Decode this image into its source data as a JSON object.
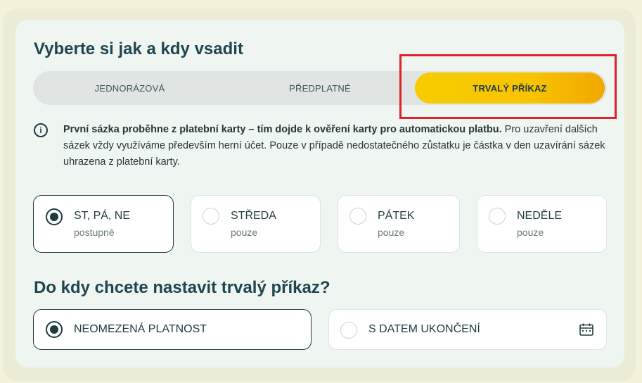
{
  "heading": "Vyberte si jak a kdy vsadit",
  "tabs": [
    {
      "label": "JEDNORÁZOVÁ"
    },
    {
      "label": "PŘEDPLATNÉ"
    },
    {
      "label": "TRVALÝ PŘÍKAZ"
    }
  ],
  "info": {
    "bold": "První sázka proběhne z platební karty – tím dojde k ověření karty pro automatickou platbu.",
    "rest": " Pro uzavření dalších sázek vždy využíváme především herní účet. Pouze v případě nedostatečného zůstatku je částka v den uzavírání sázek uhrazena z platební karty."
  },
  "days": [
    {
      "title": "ST, PÁ, NE",
      "sub": "postupně"
    },
    {
      "title": "STŘEDA",
      "sub": "pouze"
    },
    {
      "title": "PÁTEK",
      "sub": "pouze"
    },
    {
      "title": "NEDĚLE",
      "sub": "pouze"
    }
  ],
  "heading2": "Do kdy chcete nastavit trvalý příkaz?",
  "validity": [
    {
      "title": "NEOMEZENÁ PLATNOST"
    },
    {
      "title": "S DATEM UKONČENÍ"
    }
  ],
  "colors": {
    "accent": "#f6cc00",
    "dark": "#1f3a40",
    "highlight": "#e0202a"
  }
}
